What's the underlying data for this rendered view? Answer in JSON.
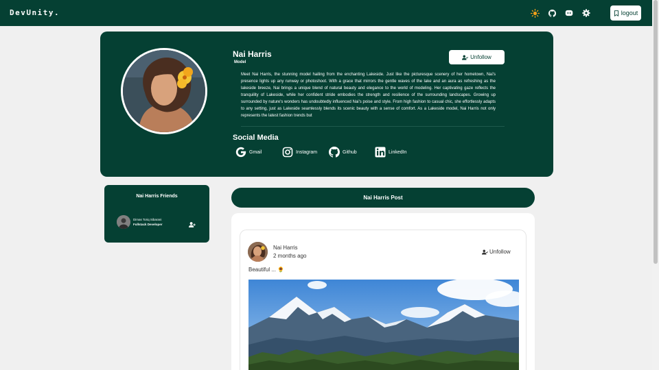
{
  "brand": "DevUnity.",
  "nav": {
    "icons": [
      "sun-icon",
      "github-icon",
      "discord-icon",
      "gear-icon"
    ],
    "logout_label": "logout"
  },
  "profile": {
    "name": "Nai Harris",
    "role": "Model",
    "unfollow_label": "Unfollow",
    "bio": "Meet Nai Harris, the stunning model hailing from the enchanting Lakeside. Just like the picturesque scenery of her hometown, Nai's presence lights up any runway or photoshoot. With a grace that mirrors the gentle waves of the lake and an aura as refreshing as the lakeside breeze, Nai brings a unique blend of natural beauty and elegance to the world of modeling. Her captivating gaze reflects the tranquility of Lakeside, while her confident stride embodies the strength and resilience of the surrounding landscapes. Growing up surrounded by nature's wonders has undoubtedly influenced Nai's poise and style. From high fashion to casual chic, she effortlessly adapts to any setting, just as Lakeside seamlessly blends its scenic beauty with a sense of comfort. As a Lakeside model, Nai Harris not only represents the latest fashion trends but",
    "social_title": "Social Media",
    "social": [
      {
        "label": "Gmail",
        "icon": "google-icon"
      },
      {
        "label": "Instagram",
        "icon": "instagram-icon"
      },
      {
        "label": "Github",
        "icon": "github-icon"
      },
      {
        "label": "LinkedIn",
        "icon": "linkedin-icon"
      }
    ]
  },
  "friends": {
    "title": "Nai Harris Friends",
    "items": [
      {
        "name": "Dimas Toriq Sibarani",
        "role": "Fullstack Developer"
      }
    ]
  },
  "posts": {
    "header": "Nai Harris Post",
    "items": [
      {
        "author": "Nai Harris",
        "time": "2 months ago",
        "unfollow_label": "Unfollow",
        "caption": "Beautiful ... 🌻"
      }
    ]
  },
  "colors": {
    "brand": "#054033",
    "page_background": "#f0f0f0",
    "accent_sun": "#f2a01a"
  }
}
